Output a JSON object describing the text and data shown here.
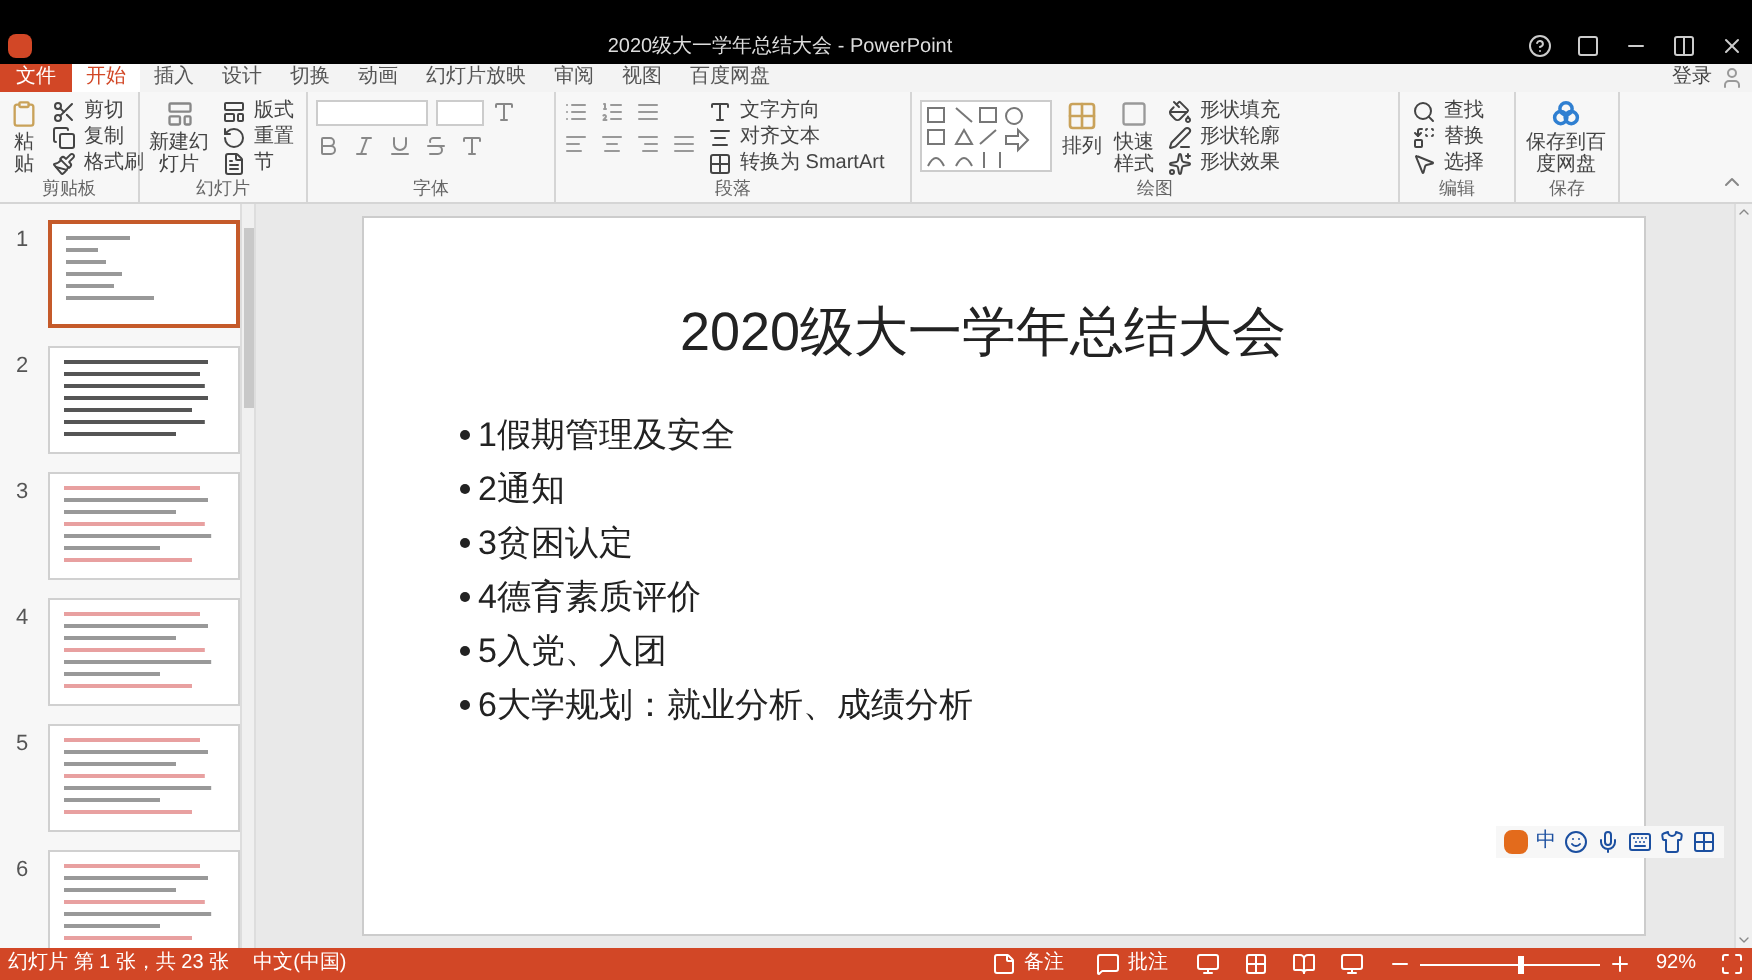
{
  "window": {
    "title": "2020级大一学年总结大会 - PowerPoint",
    "sign_in": "登录"
  },
  "tabs": [
    {
      "label": "文件",
      "kind": "file",
      "selected": false
    },
    {
      "label": "开始",
      "kind": "tab",
      "selected": true
    },
    {
      "label": "插入",
      "kind": "tab",
      "selected": false
    },
    {
      "label": "设计",
      "kind": "tab",
      "selected": false
    },
    {
      "label": "切换",
      "kind": "tab",
      "selected": false
    },
    {
      "label": "动画",
      "kind": "tab",
      "selected": false
    },
    {
      "label": "幻灯片放映",
      "kind": "tab",
      "selected": false
    },
    {
      "label": "审阅",
      "kind": "tab",
      "selected": false
    },
    {
      "label": "视图",
      "kind": "tab",
      "selected": false
    },
    {
      "label": "百度网盘",
      "kind": "tab",
      "selected": false
    }
  ],
  "ribbon": {
    "clipboard": {
      "label": "剪贴板",
      "paste": "粘贴",
      "cut": "剪切",
      "copy": "复制",
      "format_painter": "格式刷"
    },
    "slides": {
      "label": "幻灯片",
      "new_slide": "新建幻灯片",
      "layout": "版式",
      "reset": "重置",
      "section": "节"
    },
    "font": {
      "label": "字体"
    },
    "paragraph": {
      "label": "段落",
      "text_direction": "文字方向",
      "align_text": "对齐文本",
      "smartart": "转换为 SmartArt"
    },
    "drawing": {
      "label": "绘图",
      "arrange": "排列",
      "quick_styles": "快速样式",
      "fill": "形状填充",
      "outline": "形状轮廓",
      "effects": "形状效果"
    },
    "editing": {
      "label": "编辑",
      "find": "查找",
      "replace": "替换",
      "select": "选择"
    },
    "save": {
      "label": "保存",
      "save_to": "保存到百度网盘"
    }
  },
  "thumbnails": [
    {
      "number": "1",
      "selected": true
    },
    {
      "number": "2",
      "selected": false
    },
    {
      "number": "3",
      "selected": false
    },
    {
      "number": "4",
      "selected": false
    },
    {
      "number": "5",
      "selected": false
    },
    {
      "number": "6",
      "selected": false
    }
  ],
  "slide": {
    "title": "2020级大一学年总结大会",
    "bullets": [
      "1假期管理及安全",
      "2通知",
      "3贫困认定",
      "4德育素质评价",
      "5入党、入团",
      "6大学规划：就业分析、成绩分析"
    ]
  },
  "ime": {
    "mode": "中"
  },
  "status_bar": {
    "slide_info": "幻灯片 第 1 张，共 23 张",
    "language": "中文(中国)",
    "notes": "备注",
    "comments": "批注",
    "zoom": {
      "level": 0.55,
      "text": "92%"
    }
  }
}
